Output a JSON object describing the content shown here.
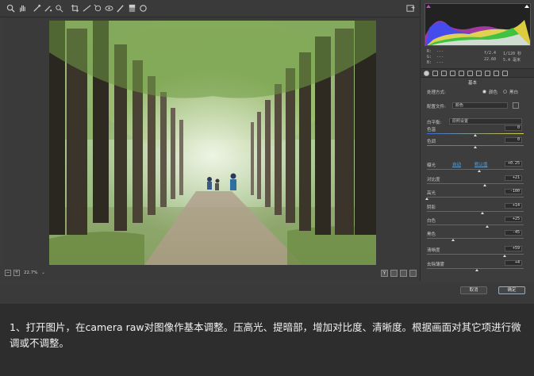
{
  "meta": {
    "aperture": "f/2.4",
    "shutter": "1/120 秒",
    "focal": "22.60",
    "zoom_ratio": "5.4 毫米",
    "rgb_r": "R:",
    "rgb_g": "G:",
    "rgb_b": "B:",
    "rgb_dash": "---"
  },
  "status": {
    "zoom": "22.7%"
  },
  "panel": {
    "section_title": "基本",
    "treatment_label": "处理方式:",
    "treatment_color": "颜色",
    "treatment_bw": "黑白",
    "profile_label": "配置文件:",
    "profile_value": "颜色",
    "wb_label": "白平衡:",
    "wb_value": "原照设置",
    "auto_label": "自动",
    "default_label": "默认值"
  },
  "sliders": [
    {
      "label": "色温",
      "value": "0",
      "pos": 0.5
    },
    {
      "label": "色调",
      "value": "0",
      "pos": 0.5
    },
    {
      "label": "曝光",
      "value": "+0.25",
      "pos": 0.54
    },
    {
      "label": "对比度",
      "value": "+21",
      "pos": 0.6
    },
    {
      "label": "高光",
      "value": "-100",
      "pos": 0.0
    },
    {
      "label": "阴影",
      "value": "+14",
      "pos": 0.57
    },
    {
      "label": "白色",
      "value": "+25",
      "pos": 0.62
    },
    {
      "label": "黑色",
      "value": "-45",
      "pos": 0.27
    },
    {
      "label": "清晰度",
      "value": "+59",
      "pos": 0.8
    },
    {
      "label": "去除薄雾",
      "value": "+4",
      "pos": 0.52
    }
  ],
  "buttons": {
    "cancel": "取消",
    "ok": "确定"
  },
  "caption": "1、打开图片，在camera raw对图像作基本调整。压高光、提暗部，增加对比度、清晰度。根据画面对其它项进行微调或不调整。",
  "colors": {
    "accent": "#5fa0d0",
    "panel": "#3d3d3d",
    "canvas": "#3a3a3a"
  },
  "histogram": {
    "channels": [
      "red",
      "green",
      "blue",
      "yellow",
      "magenta",
      "white"
    ]
  }
}
